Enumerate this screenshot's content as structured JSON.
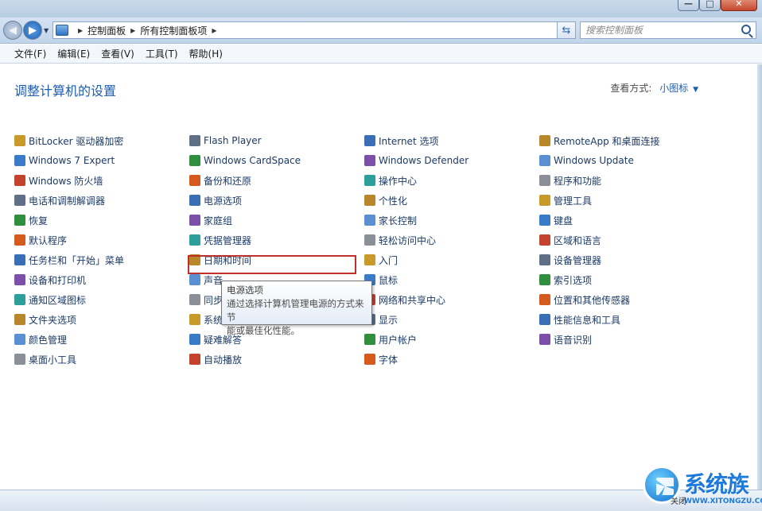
{
  "window": {
    "minimize": "—",
    "maximize": "□",
    "close": "✕"
  },
  "address": {
    "crumbs": [
      "控制面板",
      "所有控制面板项"
    ]
  },
  "search": {
    "placeholder": "搜索控制面板"
  },
  "menu": [
    "文件(F)",
    "编辑(E)",
    "查看(V)",
    "工具(T)",
    "帮助(H)"
  ],
  "header": {
    "title": "调整计算机的设置",
    "view_by_label": "查看方式:",
    "view_by_value": "小图标"
  },
  "items": {
    "col1": [
      "BitLocker 驱动器加密",
      "Windows 7 Expert",
      "Windows 防火墙",
      "电话和调制解调器",
      "恢复",
      "默认程序",
      "任务栏和「开始」菜单",
      "设备和打印机",
      "通知区域图标",
      "文件夹选项",
      "颜色管理",
      "桌面小工具"
    ],
    "col2": [
      "Flash Player",
      "Windows CardSpace",
      "备份和还原",
      "电源选项",
      "家庭组",
      "凭据管理器",
      "日期和时间",
      "声音",
      "同步中心",
      "系统",
      "疑难解答",
      "自动播放"
    ],
    "col3": [
      "Internet 选项",
      "Windows Defender",
      "操作中心",
      "个性化",
      "家长控制",
      "轻松访问中心",
      "入门",
      "鼠标",
      "网络和共享中心",
      "显示",
      "用户帐户",
      "字体"
    ],
    "col4": [
      "RemoteApp 和桌面连接",
      "Windows Update",
      "程序和功能",
      "管理工具",
      "键盘",
      "区域和语言",
      "设备管理器",
      "索引选项",
      "位置和其他传感器",
      "性能信息和工具",
      "语音识别"
    ]
  },
  "tooltip": {
    "title": "电源选项",
    "line1": "通过选择计算机管理电源的方式来节",
    "line2": "能或最佳化性能。"
  },
  "watermark": {
    "text": "系统族",
    "url": "WWW.XITONGZU.COM",
    "small": "关闭"
  },
  "icon_colors": [
    "#c79a2a",
    "#3a7bc8",
    "#c3432f",
    "#5f6f86",
    "#2f8f3e",
    "#d45a1e",
    "#3b6fb5",
    "#7c4fa8",
    "#2c9f9a",
    "#b8872b",
    "#5a8fd1",
    "#8a8f98"
  ]
}
